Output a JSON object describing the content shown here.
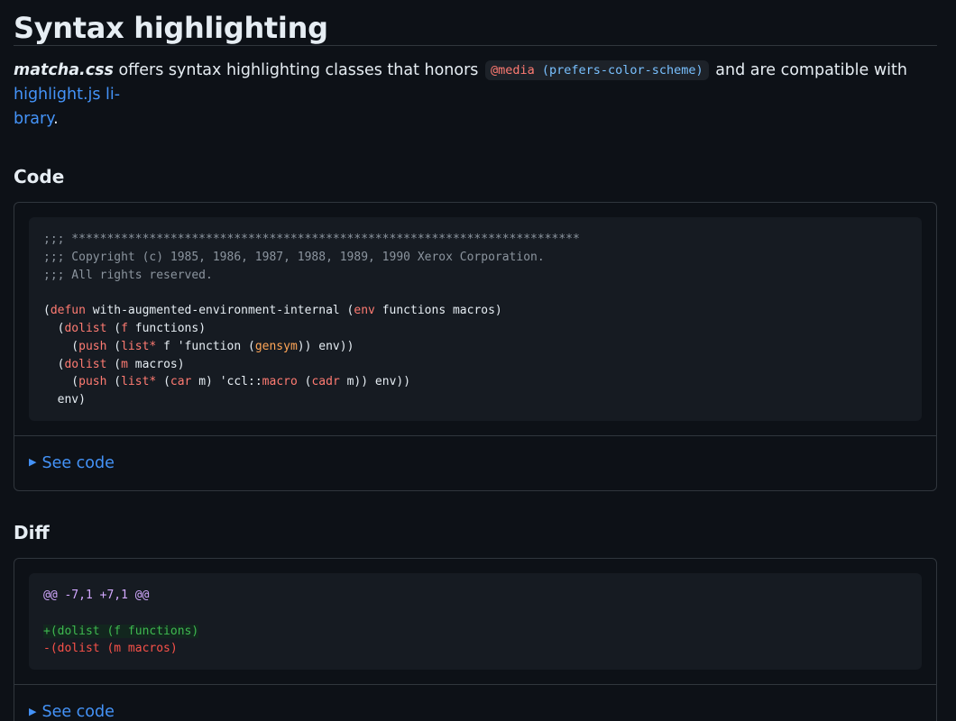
{
  "heading": "Syntax highlighting",
  "intro": {
    "brand": "matcha.css",
    "text_before_code": " offers syntax highlighting classes that honors ",
    "code_at": "@media",
    "code_rest": " (prefers-color-scheme)",
    "text_after_code": " and are compatible with ",
    "link_text": "highlight.js library",
    "text_end": "."
  },
  "code_section": {
    "title": "Code",
    "lines": {
      "c1": ";;; ************************************************************************",
      "c2": ";;; Copyright (c) 1985, 1986, 1987, 1988, 1989, 1990 Xerox Corporation.",
      "c3": ";;; All rights reserved.",
      "l1_open": "(",
      "l1_kw": "defun",
      "l1_mid": " with-augmented-environment-internal (",
      "l1_kw2": "env",
      "l1_end": " functions macros)",
      "l2_open": "  (",
      "l2_kw": "dolist",
      "l2_mid": " (",
      "l2_kw2": "f",
      "l2_end": " functions)",
      "l3_open": "    (",
      "l3_kw": "push",
      "l3_mid": " (",
      "l3_kw2": "list*",
      "l3_mid2": " f 'function (",
      "l3_kw3": "gensym",
      "l3_end": ")) env))",
      "l4_open": "  (",
      "l4_kw": "dolist",
      "l4_mid": " (",
      "l4_kw2": "m",
      "l4_end": " macros)",
      "l5_open": "    (",
      "l5_kw": "push",
      "l5_mid": " (",
      "l5_kw2": "list*",
      "l5_mid2": " (",
      "l5_kw3": "car",
      "l5_mid3": " m) 'ccl::",
      "l5_kw4": "macro",
      "l5_mid4": " (",
      "l5_kw5": "cadr",
      "l5_end": " m)) env))",
      "l6": "  env)"
    },
    "details_label": "See code"
  },
  "diff_section": {
    "title": "Diff",
    "lines": {
      "meta": "@@ -7,1 +7,1 @@",
      "add": "+(dolist (f functions)",
      "del": "-(dolist (m macros)"
    },
    "details_label": "See code"
  },
  "colors": {
    "background": "#0d1117",
    "link": "#4493f8",
    "keyword": "#ff7b72",
    "comment": "#8b949e",
    "diff_add": "#3fb950",
    "diff_del": "#f85149",
    "diff_meta": "#d2a8ff"
  },
  "icons": {
    "details_toggle": "triangle-right-icon"
  }
}
